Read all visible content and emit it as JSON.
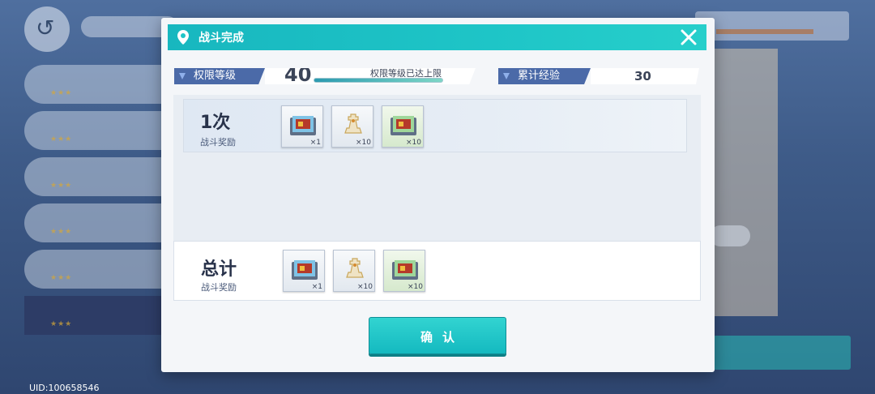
{
  "background": {
    "location_label": "",
    "stages": [
      {
        "label": "",
        "stars": "★★★"
      },
      {
        "label": "",
        "stars": "★★★"
      },
      {
        "label": "",
        "stars": "★★★"
      },
      {
        "label": "",
        "stars": "★★★"
      },
      {
        "label": "",
        "stars": "★★★"
      },
      {
        "label": "",
        "stars": "★★★"
      }
    ],
    "start_button_label": "",
    "uid": "UID:100658546"
  },
  "modal": {
    "title": "战斗完成",
    "level_label": "权限等级",
    "level_value": "40",
    "level_cap_text": "权限等级已达上限",
    "exp_label": "累计经验",
    "exp_value": "30",
    "round_reward": {
      "title": "1次",
      "subtitle": "战斗奖励",
      "items": [
        {
          "icon": "data-chip-icon",
          "qty": "×1"
        },
        {
          "icon": "chess-piece-icon",
          "qty": "×10"
        },
        {
          "icon": "data-chip-icon",
          "qty": "×10"
        }
      ]
    },
    "total_reward": {
      "title": "总计",
      "subtitle": "战斗奖励",
      "items": [
        {
          "icon": "data-chip-icon",
          "qty": "×1"
        },
        {
          "icon": "chess-piece-icon",
          "qty": "×10"
        },
        {
          "icon": "data-chip-icon",
          "qty": "×10"
        }
      ]
    },
    "confirm_label": "确认"
  },
  "colors": {
    "header_teal": "#1ec5c7",
    "tag_blue": "#4b6aa8",
    "confirm_teal": "#22c6c8"
  }
}
